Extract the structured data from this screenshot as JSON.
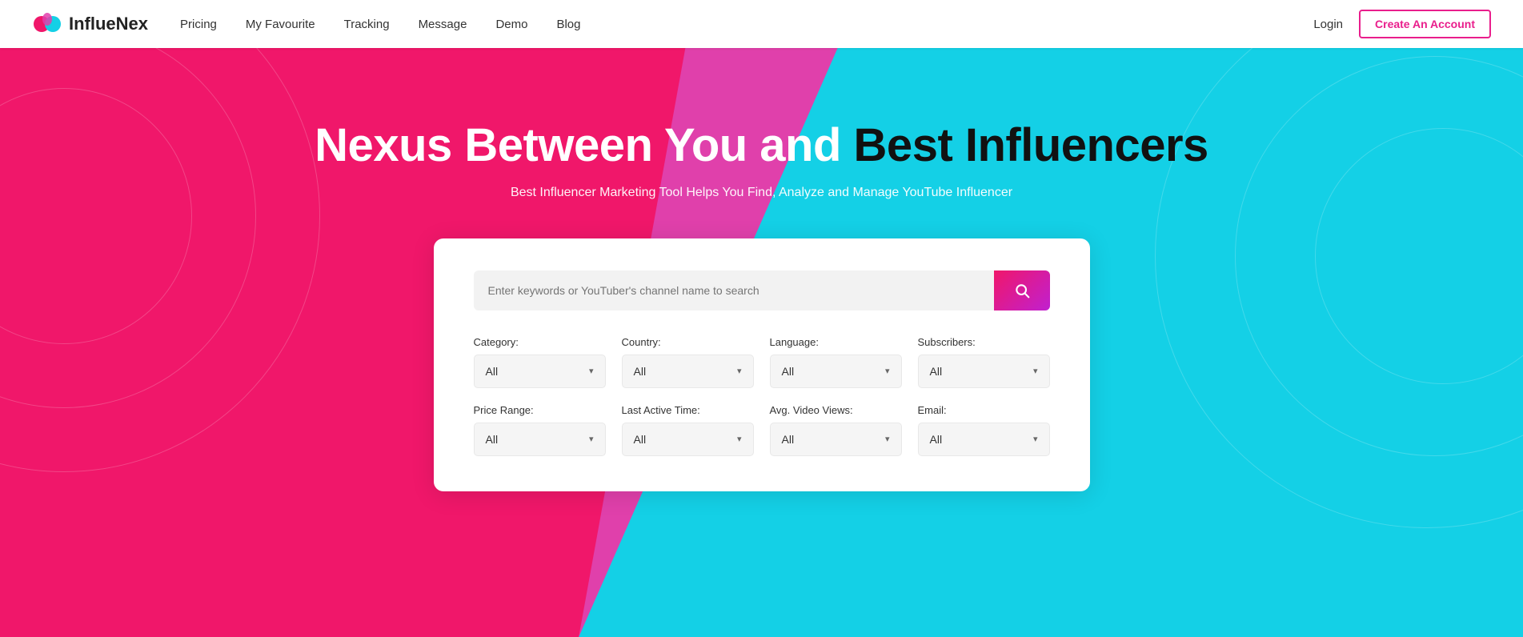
{
  "navbar": {
    "logo_text": "InflueNex",
    "nav_items": [
      {
        "label": "Pricing",
        "id": "pricing"
      },
      {
        "label": "My Favourite",
        "id": "my-favourite"
      },
      {
        "label": "Tracking",
        "id": "tracking"
      },
      {
        "label": "Message",
        "id": "message"
      },
      {
        "label": "Demo",
        "id": "demo"
      },
      {
        "label": "Blog",
        "id": "blog"
      }
    ],
    "login_label": "Login",
    "create_account_label": "Create An Account"
  },
  "hero": {
    "title_part1": "Nexus Between You and ",
    "title_part2": "Best Influencers",
    "subtitle": "Best Influencer Marketing Tool Helps You Find, Analyze and Manage YouTube Influencer"
  },
  "search": {
    "placeholder": "Enter keywords or YouTuber's channel name to search",
    "button_label": "🔍"
  },
  "filters": {
    "row1": [
      {
        "label": "Category:",
        "value": "All",
        "id": "category"
      },
      {
        "label": "Country:",
        "value": "All",
        "id": "country"
      },
      {
        "label": "Language:",
        "value": "All",
        "id": "language"
      },
      {
        "label": "Subscribers:",
        "value": "All",
        "id": "subscribers"
      }
    ],
    "row2": [
      {
        "label": "Price Range:",
        "value": "All",
        "id": "price-range"
      },
      {
        "label": "Last Active Time:",
        "value": "All",
        "id": "last-active"
      },
      {
        "label": "Avg. Video Views:",
        "value": "All",
        "id": "avg-views"
      },
      {
        "label": "Email:",
        "value": "All",
        "id": "email"
      }
    ]
  }
}
